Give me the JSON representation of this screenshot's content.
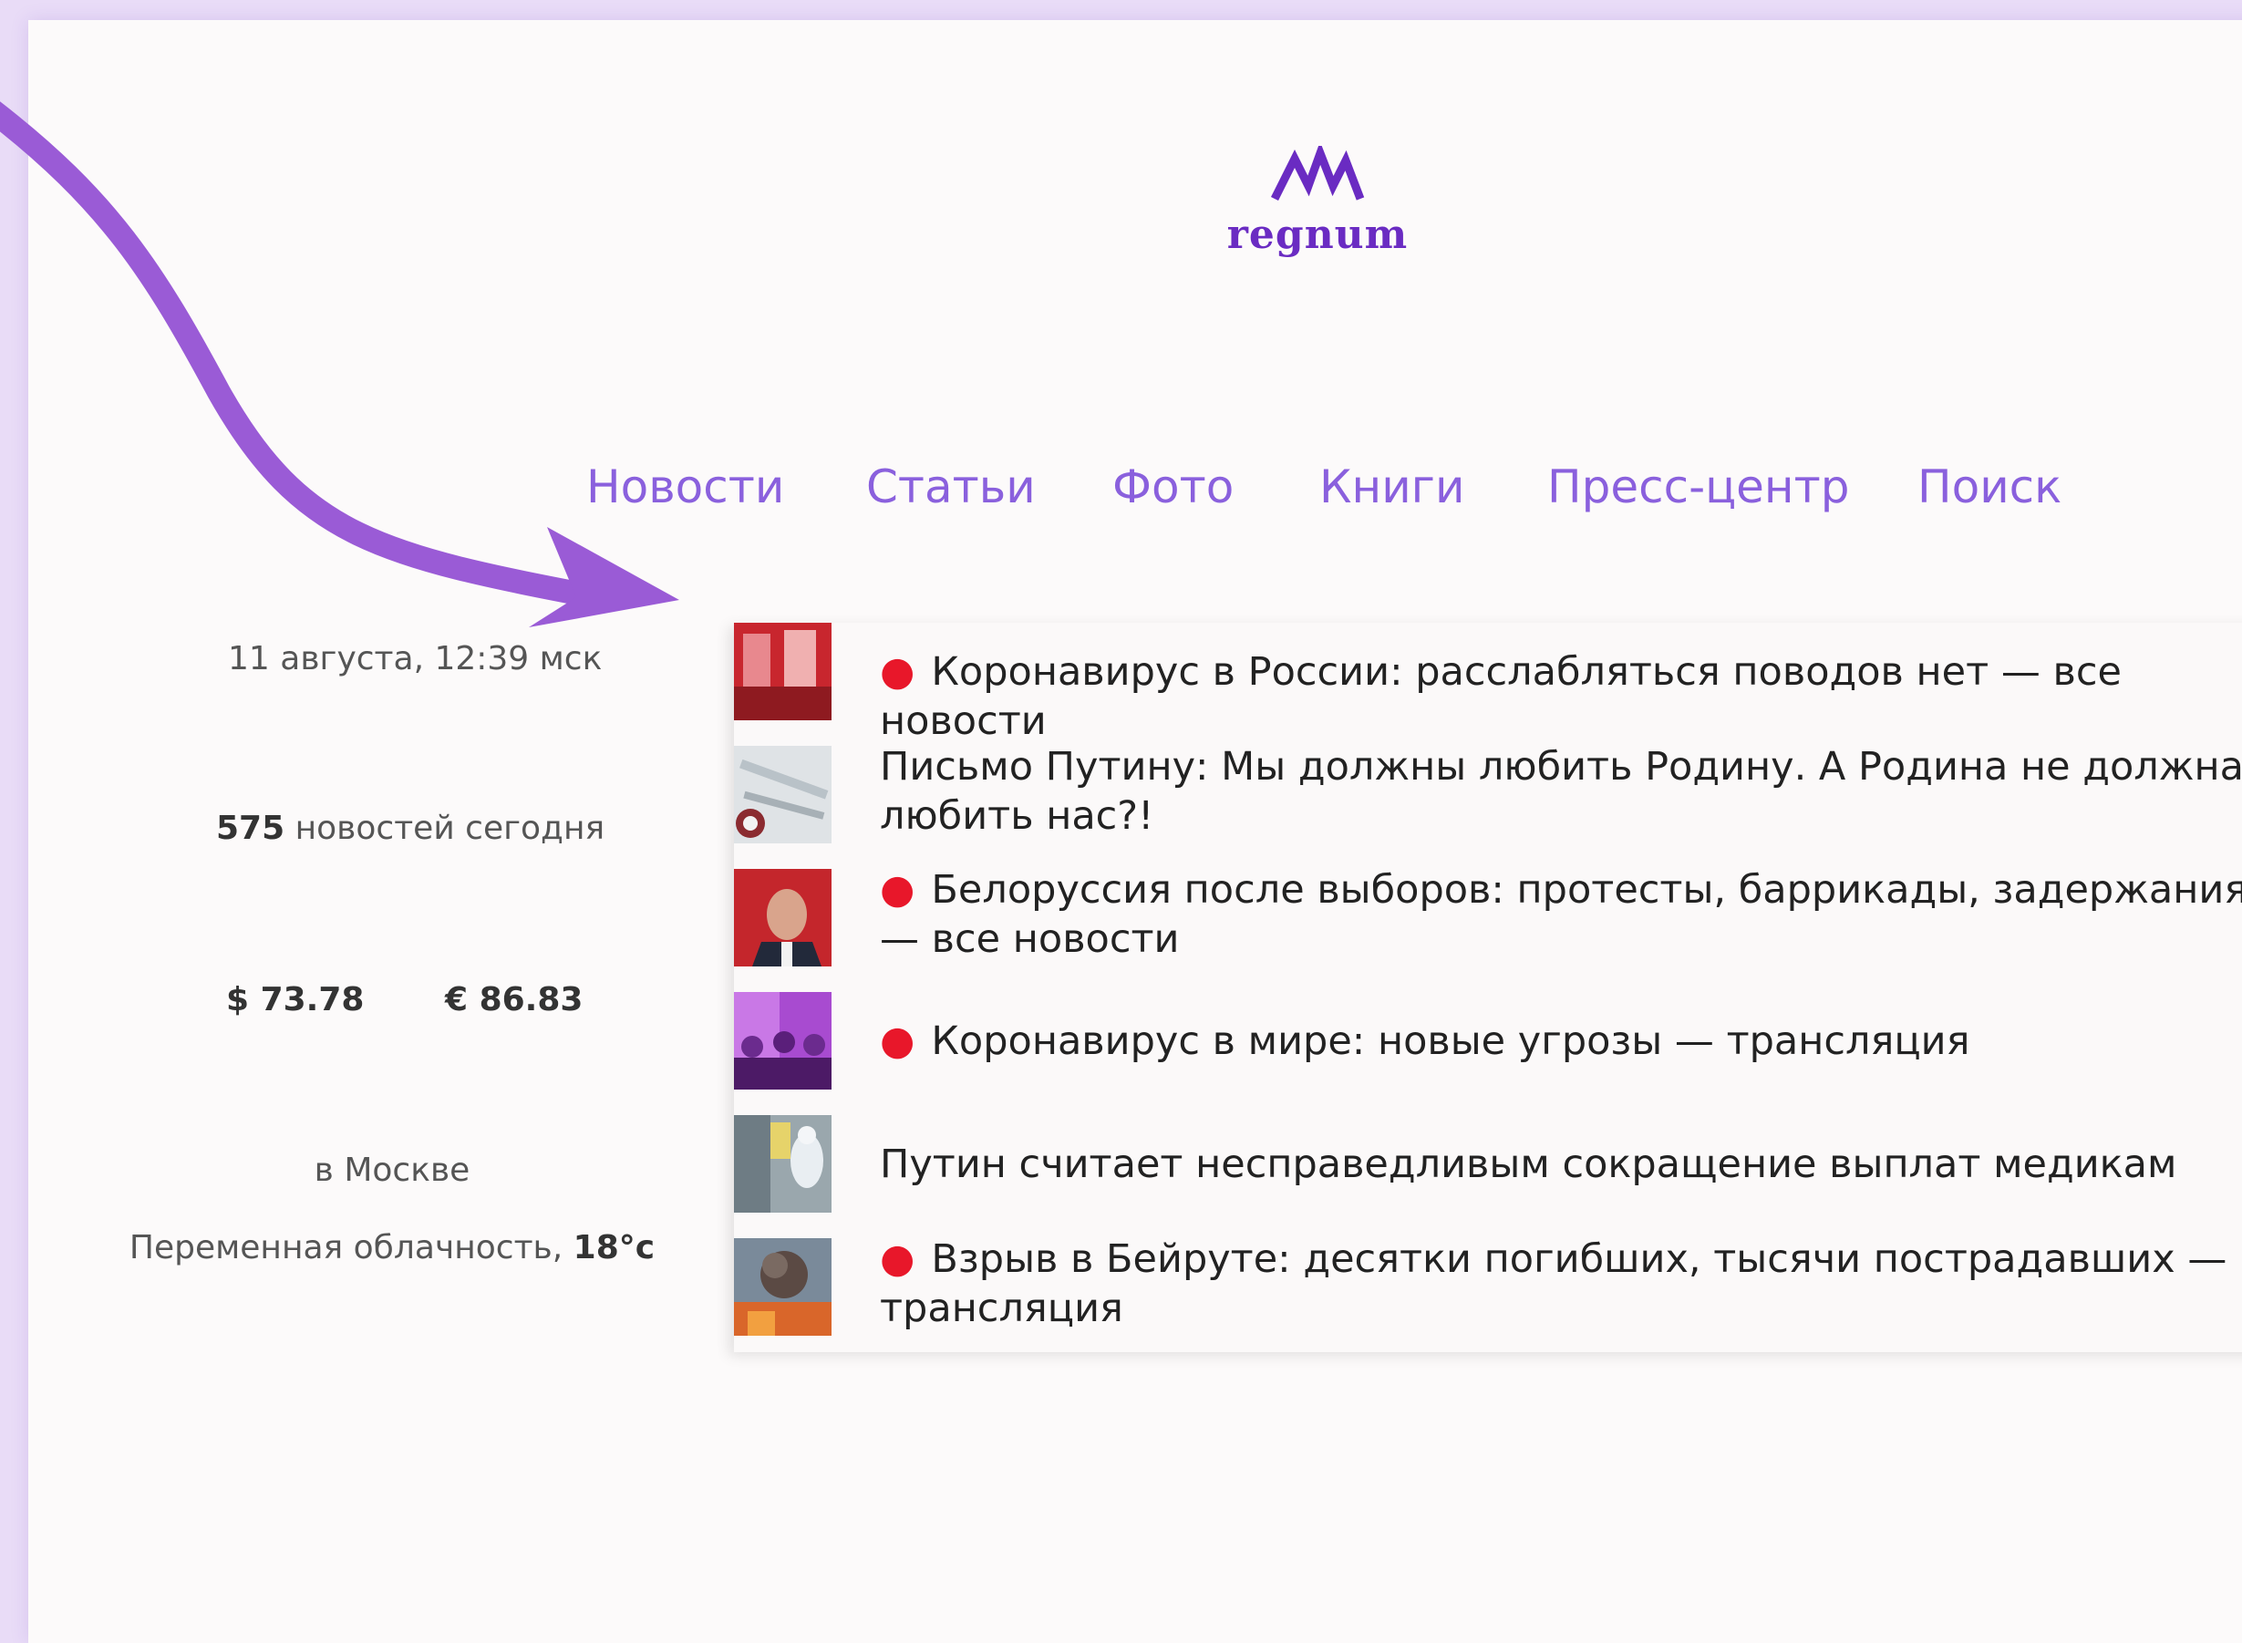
{
  "logo": {
    "text": "regnum"
  },
  "nav": [
    {
      "label": "Новости"
    },
    {
      "label": "Статьи"
    },
    {
      "label": "Фото"
    },
    {
      "label": "Книги"
    },
    {
      "label": "Пресс-центр"
    },
    {
      "label": "Поиск"
    }
  ],
  "sidebar": {
    "datetime": "11 августа, 12:39 мск",
    "news_count": "575",
    "news_count_label": "новостей сегодня",
    "usd": "$ 73.78",
    "eur": "€ 86.83",
    "city": "в Москве",
    "weather_text": "Переменная облачность,",
    "temperature": "18°c"
  },
  "news": [
    {
      "text": "Коронавирус в России: расслабляться поводов нет — все новости",
      "highlight": true
    },
    {
      "text": "Письмо Путину: Мы должны любить Родину. А Родина не должна любить нас?!",
      "highlight": false
    },
    {
      "text": "Белоруссия после выборов: протесты, баррикады, задержания — все новости",
      "highlight": true
    },
    {
      "text": "Коронавирус в мире: новые угрозы — трансляция",
      "highlight": true
    },
    {
      "text": "Путин считает несправедливым сокращение выплат медикам",
      "highlight": false
    },
    {
      "text": "Взрыв в Бейруте: десятки погибших, тысячи пострадавших — трансляция",
      "highlight": true
    }
  ],
  "colors": {
    "brand": "#6a2bc2",
    "nav": "#8a60dd",
    "bullet": "#e8172a",
    "arrow": "#9a5bd6"
  }
}
